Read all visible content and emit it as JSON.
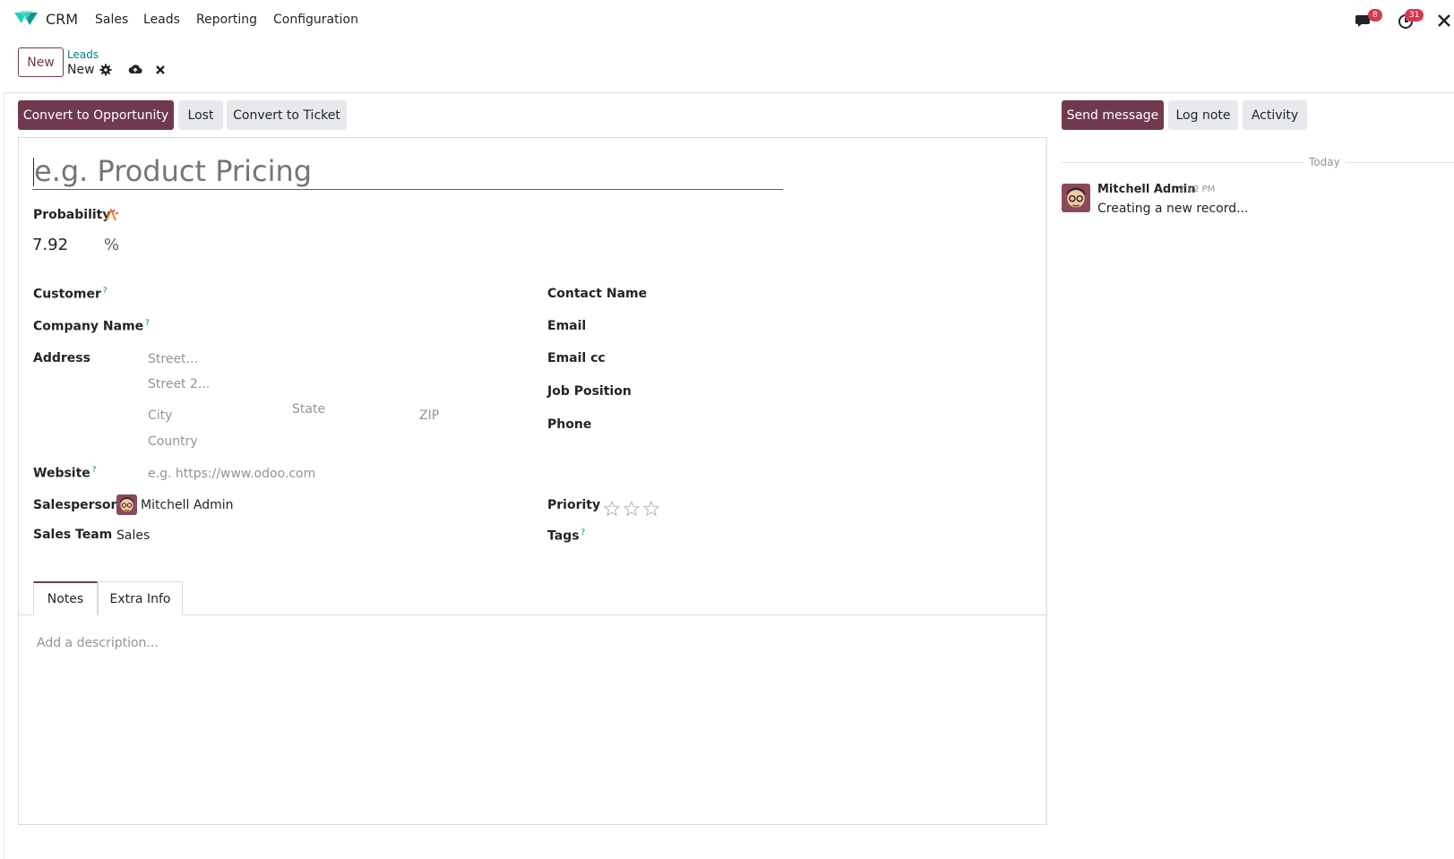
{
  "navbar": {
    "app_name": "CRM",
    "menu": [
      "Sales",
      "Leads",
      "Reporting",
      "Configuration"
    ],
    "messages_count": "8",
    "activities_count": "31"
  },
  "control_panel": {
    "new_button": "New",
    "breadcrumb_parent": "Leads",
    "breadcrumb_current": "New"
  },
  "statusbar": {
    "convert_opportunity": "Convert to Opportunity",
    "lost": "Lost",
    "convert_ticket": "Convert to Ticket"
  },
  "form": {
    "title_placeholder": "e.g. Product Pricing",
    "probability_label": "Probability",
    "probability_value": "7.92",
    "probability_unit": "%",
    "customer_label": "Customer",
    "company_label": "Company Name",
    "address_label": "Address",
    "street_placeholder": "Street...",
    "street2_placeholder": "Street 2...",
    "city_placeholder": "City",
    "state_placeholder": "State",
    "zip_placeholder": "ZIP",
    "country_placeholder": "Country",
    "website_label": "Website",
    "website_placeholder": "e.g. https://www.odoo.com",
    "salesperson_label": "Salesperson",
    "salesperson_value": "Mitchell Admin",
    "sales_team_label": "Sales Team",
    "sales_team_value": "Sales",
    "contact_name_label": "Contact Name",
    "email_label": "Email",
    "email_cc_label": "Email cc",
    "job_position_label": "Job Position",
    "phone_label": "Phone",
    "priority_label": "Priority",
    "tags_label": "Tags",
    "help_mark": "?"
  },
  "tabs": {
    "notes": "Notes",
    "extra_info": "Extra Info",
    "description_placeholder": "Add a description..."
  },
  "chatter": {
    "send_message": "Send message",
    "log_note": "Log note",
    "activity": "Activity",
    "date_separator": "Today",
    "author": "Mitchell Admin",
    "time": "2:02 PM",
    "message": "Creating a new record..."
  },
  "colors": {
    "brand": "#71394f",
    "link": "#017e84",
    "badge": "#d9364f"
  }
}
